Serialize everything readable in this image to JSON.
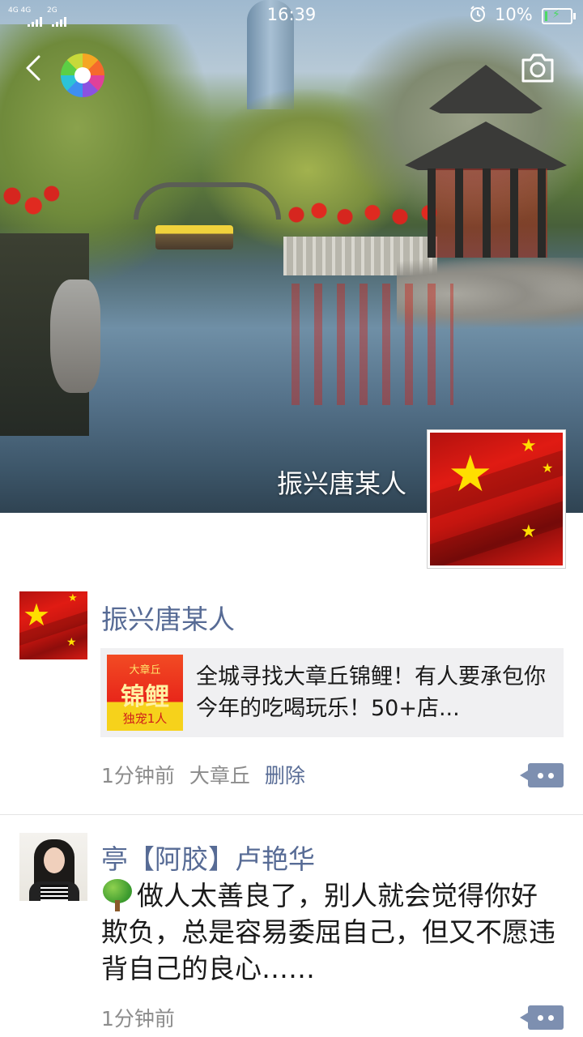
{
  "status_bar": {
    "signal_1": "4G 4G",
    "signal_2": "2G",
    "time": "16:39",
    "battery_percent": "10%",
    "battery_level": 0.1,
    "charging": true
  },
  "header": {
    "back_icon": "chevron-left-icon",
    "app_icon": "shutter-icon",
    "camera_icon": "camera-icon"
  },
  "cover": {
    "name": "振兴唐某人",
    "avatar": "china-flag"
  },
  "posts": [
    {
      "author": "振兴唐某人",
      "avatar": "china-flag",
      "share": {
        "thumb_top": "大章丘",
        "thumb_main": "锦鲤",
        "thumb_bottom": "独宠1人",
        "text": "全城寻找大章丘锦鲤！有人要承包你今年的吃喝玩乐！50+店..."
      },
      "time": "1分钟前",
      "location": "大章丘",
      "delete_label": "删除"
    },
    {
      "author": "亭【阿胶】卢艳华",
      "avatar": "woman-photo",
      "emoji": "tree",
      "text": "做人太善良了，别人就会觉得你好欺负，总是容易委屈自己，但又不愿违背自己的良心……",
      "time": "1分钟前"
    }
  ],
  "colors": {
    "link_blue": "#576b95",
    "meta_gray": "#8c8c8c",
    "share_bg": "#f0f0f2",
    "more_button": "#7d8fb0"
  }
}
